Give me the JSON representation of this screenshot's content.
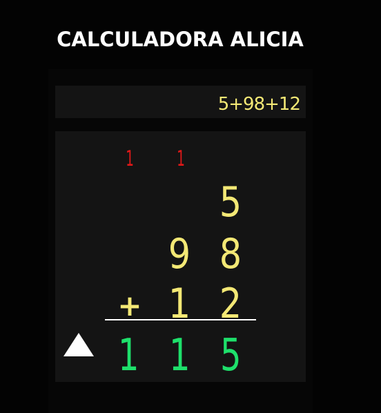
{
  "app": {
    "title": "CALCULADORA ALICIA"
  },
  "display": {
    "expression": "5+98+12"
  },
  "operation": {
    "carries": [
      "1",
      "1"
    ],
    "rows": [
      [
        "5"
      ],
      [
        "9",
        "8"
      ],
      [
        "1",
        "2"
      ]
    ],
    "operator": "+",
    "result": [
      "1",
      "1",
      "5"
    ]
  },
  "controls": {
    "toggle_icon": "triangle-up-icon"
  },
  "colors": {
    "background": "#030303",
    "panel": "#141414",
    "operand": "#f3e875",
    "carry": "#e01818",
    "result": "#1ee06b",
    "title": "#ffffff"
  }
}
